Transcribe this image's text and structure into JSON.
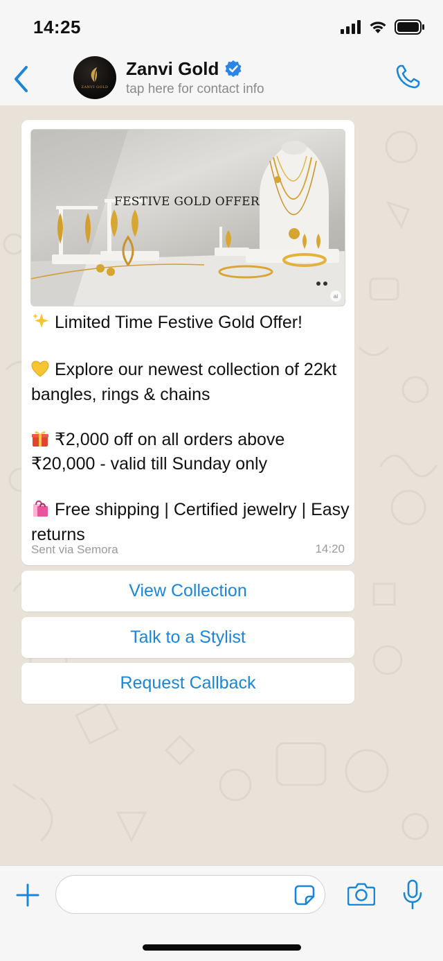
{
  "status_bar": {
    "time": "14:25"
  },
  "header": {
    "contact_name": "Zanvi Gold",
    "subtitle": "tap here for contact info",
    "avatar_text": "ZANVI GOLD",
    "accent_color": "#1a86d9",
    "verified_color": "#2a85e6"
  },
  "message": {
    "image_caption": "FESTIVE GOLD OFFER",
    "image_badge": "ai",
    "paragraphs": [
      {
        "emoji": "sparkles-emoji",
        "text": "Limited Time Festive Gold Offer!"
      },
      {
        "emoji": "yellow-heart-emoji",
        "text": "Explore our newest collection of 22kt bangles, rings & chains"
      },
      {
        "emoji": "gift-emoji",
        "text": "₹2,000 off on all orders above ₹20,000 - valid till Sunday only"
      },
      {
        "emoji": "shopping-bags-emoji",
        "text": "Free shipping | Certified jewelry | Easy returns"
      }
    ],
    "sent_via": "Sent via Semora",
    "time": "14:20"
  },
  "quick_replies": [
    {
      "label": "View Collection"
    },
    {
      "label": "Talk to a Stylist"
    },
    {
      "label": "Request Callback"
    }
  ],
  "input_bar": {
    "placeholder": ""
  },
  "colors": {
    "chat_background": "#e8e2d9",
    "bubble": "#ffffff",
    "link_blue": "#1a86d9"
  }
}
